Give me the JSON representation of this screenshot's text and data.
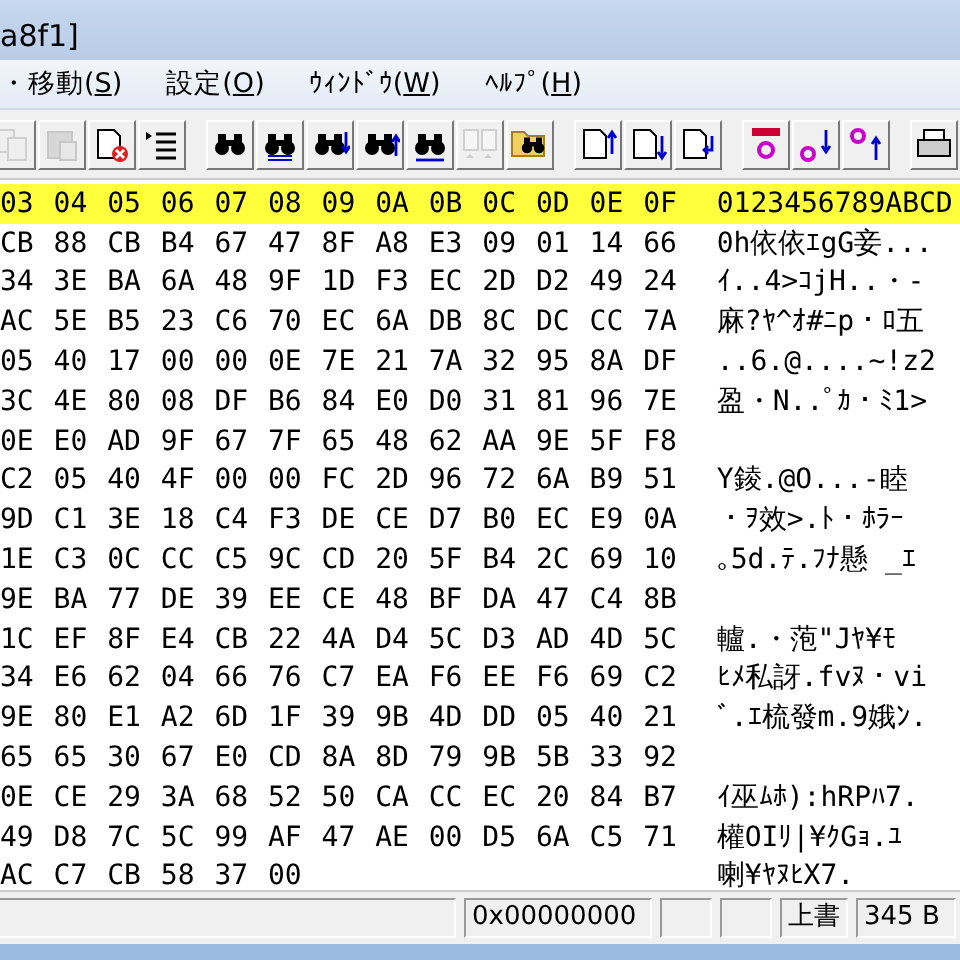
{
  "window": {
    "title": "a8f1]"
  },
  "menu": [
    {
      "before": "・移動(",
      "key": "S",
      "after": ")"
    },
    {
      "before": "設定(",
      "key": "O",
      "after": ")"
    },
    {
      "before": "ｳｨﾝﾄﾞｳ(",
      "key": "W",
      "after": ")"
    },
    {
      "before": "ﾍﾙﾌﾟ(",
      "key": "H",
      "after": ")"
    }
  ],
  "toolbar": [
    [
      {
        "kind": "copy",
        "disabled": true
      },
      {
        "kind": "paste",
        "disabled": true
      },
      {
        "kind": "delete",
        "disabled": false
      },
      {
        "kind": "list",
        "disabled": false
      }
    ],
    [
      {
        "kind": "find",
        "disabled": false
      },
      {
        "kind": "replace",
        "disabled": false
      },
      {
        "kind": "find-down",
        "disabled": false
      },
      {
        "kind": "find-up",
        "disabled": false
      },
      {
        "kind": "find-ab",
        "disabled": false
      },
      {
        "kind": "compare",
        "disabled": true
      },
      {
        "kind": "folder-find",
        "disabled": false
      }
    ],
    [
      {
        "kind": "doc-up",
        "disabled": false
      },
      {
        "kind": "doc-down",
        "disabled": false
      },
      {
        "kind": "doc-enter",
        "disabled": false
      }
    ],
    [
      {
        "kind": "mark",
        "disabled": false
      },
      {
        "kind": "mark-down",
        "disabled": false
      },
      {
        "kind": "mark-up",
        "disabled": false
      }
    ],
    [
      {
        "kind": "print",
        "disabled": false
      }
    ]
  ],
  "hex": {
    "columns": [
      "03",
      "04",
      "05",
      "06",
      "07",
      "08",
      "09",
      "0A",
      "0B",
      "0C",
      "0D",
      "0E",
      "0F"
    ],
    "text_header": "0123456789ABCD",
    "rows": [
      {
        "bytes": [
          "CB",
          "88",
          "CB",
          "B4",
          "67",
          "47",
          "8F",
          "A8",
          "E3",
          "09",
          "01",
          "14",
          "66"
        ],
        "text": "0h依依ｴgG妾..."
      },
      {
        "bytes": [
          "34",
          "3E",
          "BA",
          "6A",
          "48",
          "9F",
          "1D",
          "F3",
          "EC",
          "2D",
          "D2",
          "49",
          "24"
        ],
        "text": "ｲ..4>ｺjH..・-"
      },
      {
        "bytes": [
          "AC",
          "5E",
          "B5",
          "23",
          "C6",
          "70",
          "EC",
          "6A",
          "DB",
          "8C",
          "DC",
          "CC",
          "7A"
        ],
        "text": "麻?ﾔ^ｵ#ﾆp・ﾛ五"
      },
      {
        "bytes": [
          "05",
          "40",
          "17",
          "00",
          "00",
          "0E",
          "7E",
          "21",
          "7A",
          "32",
          "95",
          "8A",
          "DF"
        ],
        "text": "..6.@....~!z2"
      },
      {
        "bytes": [
          "3C",
          "4E",
          "80",
          "08",
          "DF",
          "B6",
          "84",
          "E0",
          "D0",
          "31",
          "81",
          "96",
          "7E"
        ],
        "text": "盈・N..ﾟｶ・ﾐ1>"
      },
      {
        "bytes": [
          "0E",
          "E0",
          "AD",
          "9F",
          "67",
          "7F",
          "65",
          "48",
          "62",
          "AA",
          "9E",
          "5F",
          "F8"
        ]
      },
      {
        "bytes": [
          "C2",
          "05",
          "40",
          "4F",
          "00",
          "00",
          "FC",
          "2D",
          "96",
          "72",
          "6A",
          "B9",
          "51"
        ],
        "text": " Y錂.@O...-睦"
      },
      {
        "bytes": [
          "9D",
          "C1",
          "3E",
          "18",
          "C4",
          "F3",
          "DE",
          "CE",
          "D7",
          "B0",
          "EC",
          "E9",
          "0A"
        ],
        "text": "・ｦ效>.ﾄ・ﾎﾗｰ"
      },
      {
        "bytes": [
          "1E",
          "C3",
          "0C",
          "CC",
          "C5",
          "9C",
          "CD",
          "20",
          "5F",
          "B4",
          "2C",
          "69",
          "10"
        ],
        "text": "｡5d.ﾃ.ﾌﾅ懸 _ｴ"
      },
      {
        "bytes": [
          "9E",
          "BA",
          "77",
          "DE",
          "39",
          "EE",
          "CE",
          "48",
          "BF",
          "DA",
          "47",
          "C4",
          "8B"
        ]
      },
      {
        "bytes": [
          "1C",
          "EF",
          "8F",
          "E4",
          "CB",
          "22",
          "4A",
          "D4",
          "5C",
          "D3",
          "AD",
          "4D",
          "5C"
        ],
        "text": " 轤.・萢\"Jﾔ¥ﾓ"
      },
      {
        "bytes": [
          "34",
          "E6",
          "62",
          "04",
          "66",
          "76",
          "C7",
          "EA",
          "F6",
          "EE",
          "F6",
          "69",
          "C2"
        ],
        "text": "ﾋﾒ私訝.fvﾇ・vi"
      },
      {
        "bytes": [
          "9E",
          "80",
          "E1",
          "A2",
          "6D",
          "1F",
          "39",
          "9B",
          "4D",
          "DD",
          "05",
          "40",
          "21"
        ],
        "text": "ﾞ.ｴ梳發m.9娥ﾝ."
      },
      {
        "bytes": [
          "65",
          "65",
          "30",
          "67",
          "E0",
          "CD",
          "8A",
          "8D",
          "79",
          "9B",
          "5B",
          "33",
          "92"
        ]
      },
      {
        "bytes": [
          "0E",
          "CE",
          "29",
          "3A",
          "68",
          "52",
          "50",
          "CA",
          "CC",
          "EC",
          "20",
          "84",
          "B7"
        ],
        "text": " ｲ巫ﾑﾎ):hRPﾊ7."
      },
      {
        "bytes": [
          "49",
          "D8",
          "7C",
          "5C",
          "99",
          "AF",
          "47",
          "AE",
          "00",
          "D5",
          "6A",
          "C5",
          "71"
        ],
        "text": "權OIﾘ|¥ｸGｮ.ﾕ"
      },
      {
        "bytes": [
          "AC",
          "C7",
          "CB",
          "58",
          "37",
          "00"
        ],
        "text": "喇¥ﾔﾇﾋX7."
      }
    ]
  },
  "status_bar": {
    "offset": "0x00000000",
    "mode": "上書",
    "size": "345 B"
  }
}
